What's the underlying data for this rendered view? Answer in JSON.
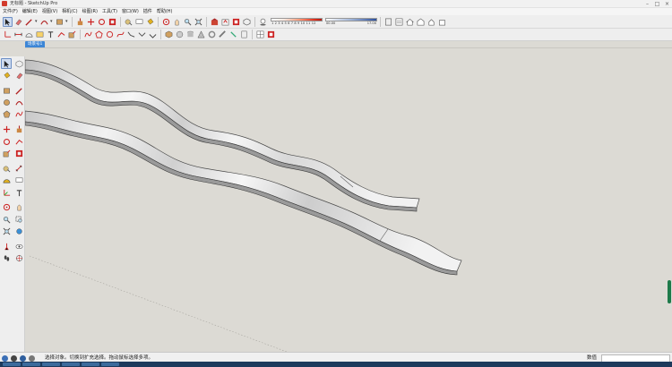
{
  "window": {
    "title": "无标题 - SketchUp Pro",
    "min_glyph": "–",
    "max_glyph": "□",
    "close_glyph": "×"
  },
  "menu": [
    "文件(F)",
    "编辑(E)",
    "视图(V)",
    "相机(C)",
    "绘图(R)",
    "工具(T)",
    "窗口(W)",
    "插件",
    "帮助(H)"
  ],
  "toolbar1": {
    "scale_labels": "1 2 3 4 5 6 7 8 9 10 11 12",
    "range_low": "00.00",
    "range_high": "17.00"
  },
  "scene_tab": "场景号1",
  "status": {
    "text": "选择对象。切换到扩充选择。拖动鼠标选择多项。",
    "measure_label": "数值",
    "measure_value": ""
  },
  "colors": {
    "accent": "#3d86d6",
    "selected_tool": "#cfdcf0",
    "ribbon_face": "#f4f4f4",
    "ribbon_edge": "#b6b6b6",
    "background": "#dcdad4"
  }
}
